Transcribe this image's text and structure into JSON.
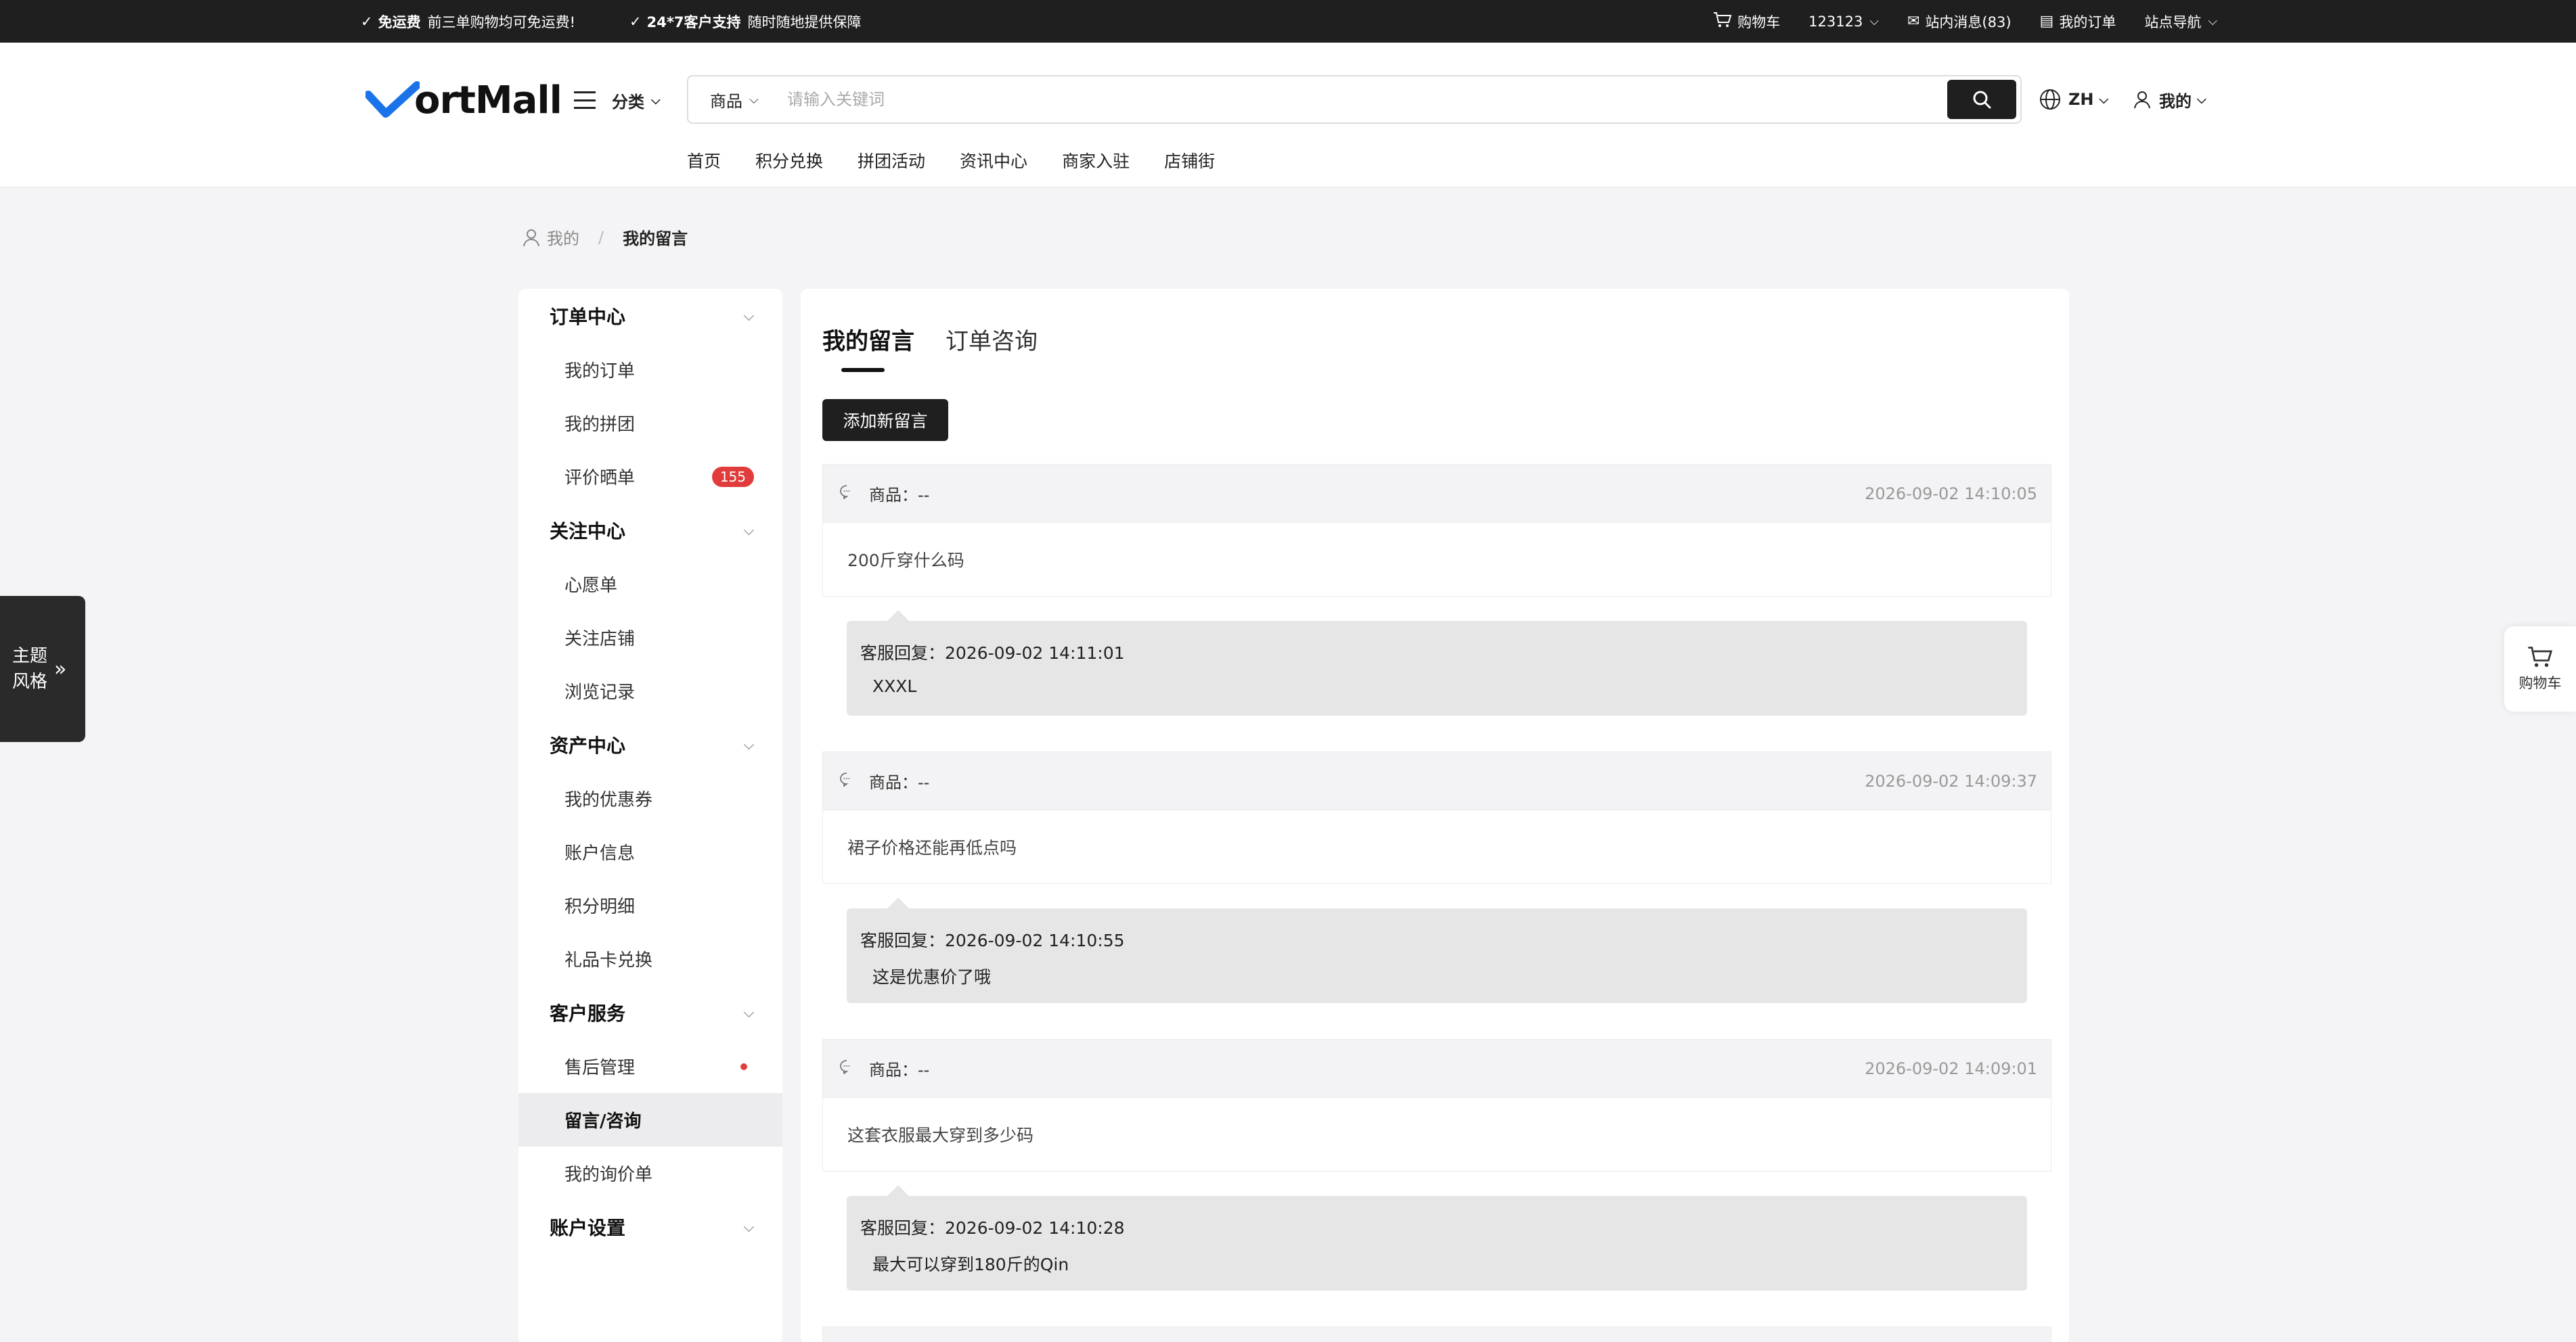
{
  "topbar": {
    "promo1_title": "免运费",
    "promo1_text": "前三单购物均可免运费!",
    "promo2_title": "24*7客户支持",
    "promo2_text": "随时随地提供保障",
    "cart": "购物车",
    "user": "123123",
    "messages": "站内消息(83)",
    "orders": "我的订单",
    "site_nav": "站点导航"
  },
  "header": {
    "logo": "ortMall",
    "category": "分类",
    "search_scope": "商品",
    "search_placeholder": "请输入关键词",
    "lang": "ZH",
    "mine": "我的",
    "nav": [
      "首页",
      "积分兑换",
      "拼团活动",
      "资讯中心",
      "商家入驻",
      "店铺街"
    ]
  },
  "breadcrumb": {
    "root": "我的",
    "current": "我的留言"
  },
  "theme_tab": {
    "line1": "主题",
    "line2": "风格"
  },
  "cart_float": "购物车",
  "sidebar": {
    "groups": [
      {
        "title": "订单中心",
        "items": [
          "我的订单",
          "我的拼团",
          "评价晒单"
        ]
      },
      {
        "title": "关注中心",
        "items": [
          "心愿单",
          "关注店铺",
          "浏览记录"
        ]
      },
      {
        "title": "资产中心",
        "items": [
          "我的优惠券",
          "账户信息",
          "积分明细",
          "礼品卡兑换"
        ]
      },
      {
        "title": "客户服务",
        "items": [
          "售后管理",
          "留言/咨询",
          "我的询价单"
        ]
      },
      {
        "title": "账户设置",
        "items": []
      }
    ],
    "review_badge": "155"
  },
  "main": {
    "tabs": [
      "我的留言",
      "订单咨询"
    ],
    "add_button": "添加新留言",
    "messages": [
      {
        "product": "商品：--",
        "time": "2026-09-02 14:10:05",
        "content": "200斤穿什么码",
        "reply_label": "客服回复：2026-09-02 14:11:01",
        "reply": "XXXL"
      },
      {
        "product": "商品：--",
        "time": "2026-09-02 14:09:37",
        "content": "裙子价格还能再低点吗",
        "reply_label": "客服回复：2026-09-02 14:10:55",
        "reply": "这是优惠价了哦"
      },
      {
        "product": "商品：--",
        "time": "2026-09-02 14:09:01",
        "content": "这套衣服最大穿到多少码",
        "reply_label": "客服回复：2026-09-02 14:10:28",
        "reply": "最大可以穿到180斤的Qin"
      }
    ]
  }
}
